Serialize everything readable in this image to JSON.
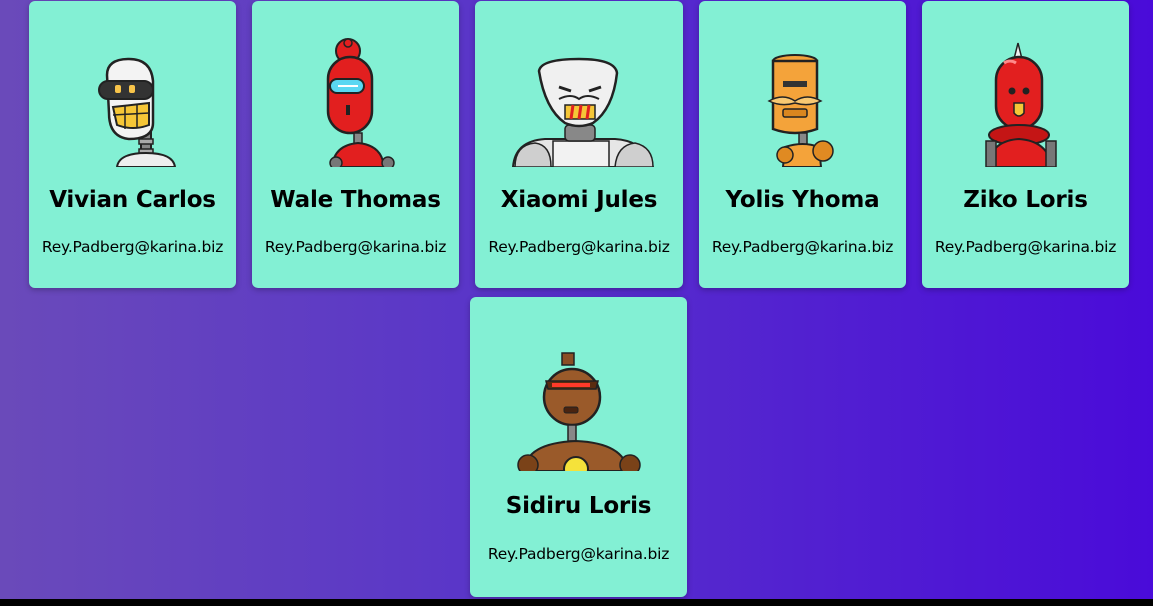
{
  "colors": {
    "card_background": "#83f0d4",
    "page_gradient_start": "#6a4aba",
    "page_gradient_end": "#4a0bd9"
  },
  "cards": [
    {
      "name": "Vivian Carlos",
      "email": "Rey.Padberg@karina.biz",
      "avatar": "white-robot-icon"
    },
    {
      "name": "Wale Thomas",
      "email": "Rey.Padberg@karina.biz",
      "avatar": "red-robot-icon"
    },
    {
      "name": "Xiaomi Jules",
      "email": "Rey.Padberg@karina.biz",
      "avatar": "grey-robot-icon"
    },
    {
      "name": "Yolis Yhoma",
      "email": "Rey.Padberg@karina.biz",
      "avatar": "orange-robot-icon"
    },
    {
      "name": "Ziko Loris",
      "email": "Rey.Padberg@karina.biz",
      "avatar": "red-spike-robot-icon"
    },
    {
      "name": "Sidiru Loris",
      "email": "Rey.Padberg@karina.biz",
      "avatar": "brown-robot-icon"
    }
  ]
}
